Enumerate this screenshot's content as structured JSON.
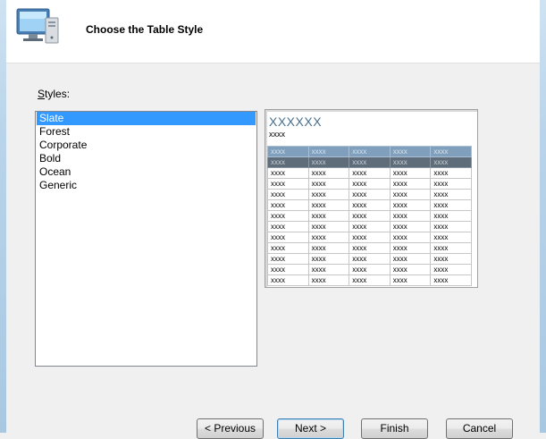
{
  "header": {
    "title": "Choose the Table Style"
  },
  "styles": {
    "label_underlined": "S",
    "label_rest": "tyles:",
    "items": [
      "Slate",
      "Forest",
      "Corporate",
      "Bold",
      "Ocean",
      "Generic"
    ],
    "selected_index": 0
  },
  "preview": {
    "title": "XXXXXX",
    "subtitle": "xxxx",
    "cell": "xxxx",
    "columns": 5,
    "rows": 13
  },
  "buttons": {
    "previous": "< Previous",
    "next": "Next >",
    "finish": "Finish",
    "cancel": "Cancel"
  }
}
